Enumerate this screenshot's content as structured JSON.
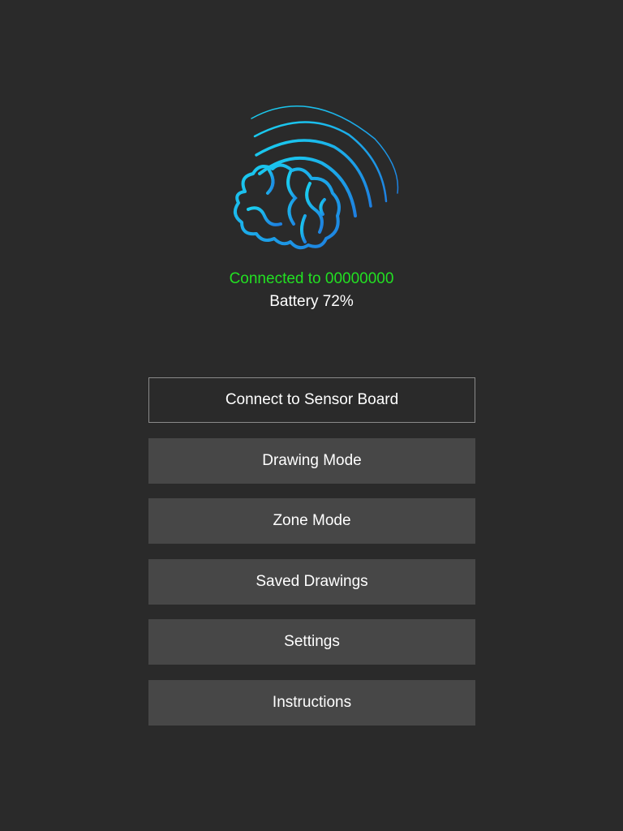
{
  "status": {
    "connected_text": "Connected to 00000000",
    "connected_color": "#22e022",
    "battery_text": "Battery 72%"
  },
  "logo": {
    "icon": "brain-signal-icon",
    "gradient_start": "#1ad0f0",
    "gradient_end": "#1e7fe0"
  },
  "menu": {
    "items": [
      {
        "label": "Connect to Sensor Board",
        "style": "outlined"
      },
      {
        "label": "Drawing Mode",
        "style": "filled"
      },
      {
        "label": "Zone Mode",
        "style": "filled"
      },
      {
        "label": "Saved Drawings",
        "style": "filled"
      },
      {
        "label": "Settings",
        "style": "filled"
      },
      {
        "label": "Instructions",
        "style": "filled"
      }
    ]
  }
}
